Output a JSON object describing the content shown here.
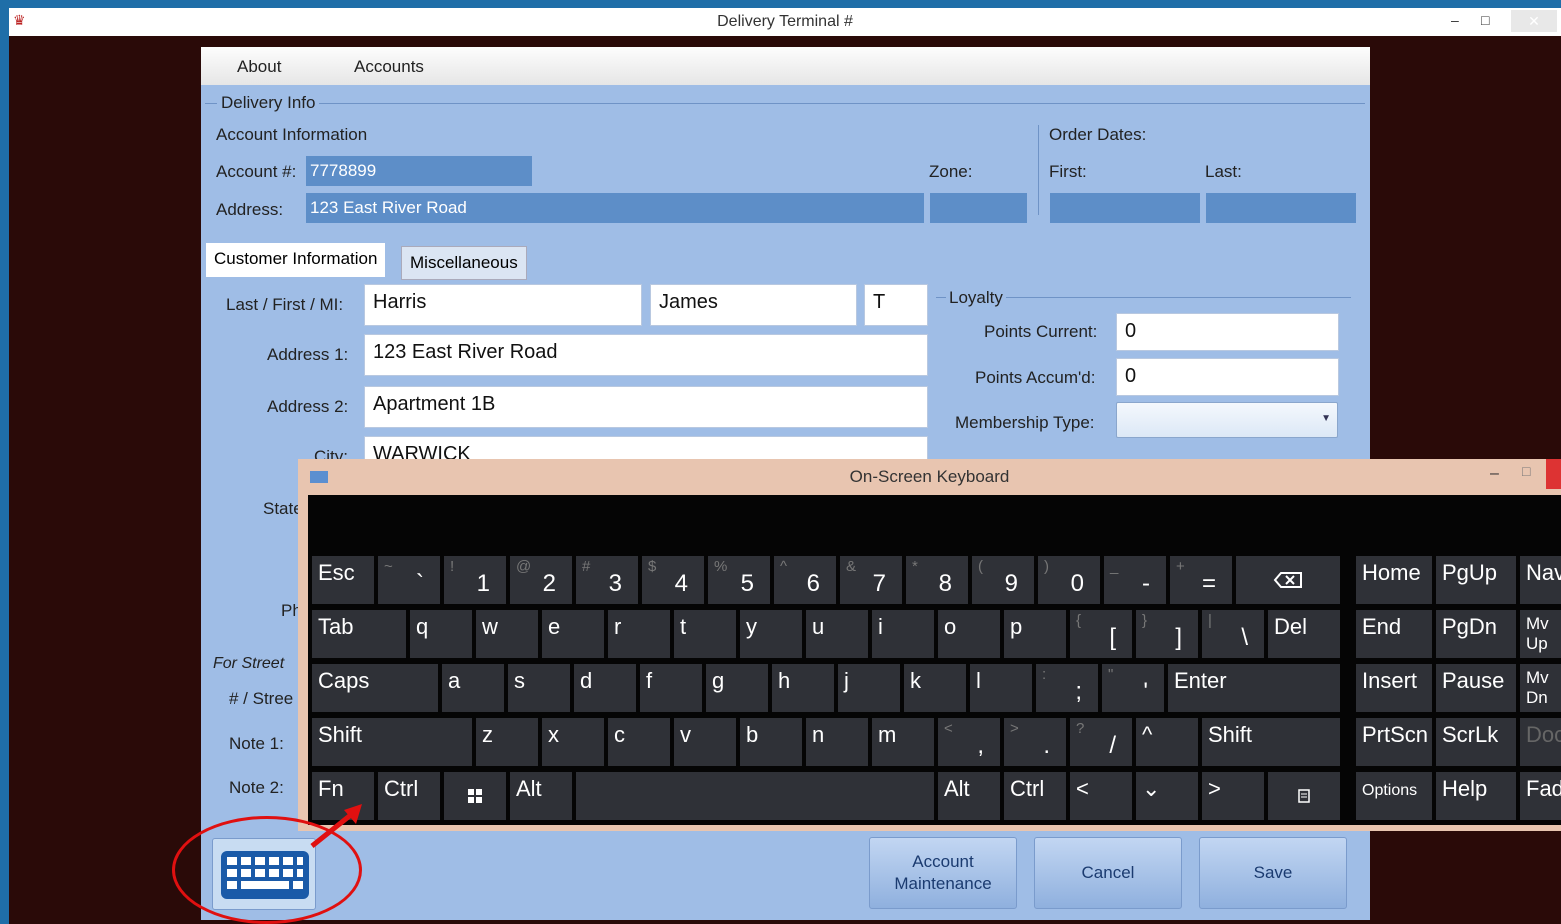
{
  "window": {
    "title": "Delivery Terminal #",
    "minimize": "–",
    "restore": "□",
    "close": "✕"
  },
  "menu": {
    "items": [
      "About",
      "Accounts"
    ]
  },
  "delivery": {
    "legend": "Delivery Info",
    "account_info": "Account Information",
    "account_label": "Account #:",
    "account_value": "7778899",
    "address_label": "Address:",
    "address_value": "123 East River Road",
    "zone_label": "Zone:",
    "order_dates": "Order Dates:",
    "first": "First:",
    "last": "Last:"
  },
  "tabs": [
    "Customer Information",
    "Miscellaneous"
  ],
  "customer": {
    "name_label": "Last / First / MI:",
    "last": "Harris",
    "first": "James",
    "mi": "T",
    "addr1_label": "Address 1:",
    "addr1": "123 East River Road",
    "addr2_label": "Address 2:",
    "addr2": "Apartment 1B",
    "city_label": "City:",
    "city": "WARWICK",
    "state_label": "State",
    "ph_label": "Ph",
    "street_legend": "For Street",
    "street_label": "# / Stree",
    "note1": "Note 1:",
    "note2": "Note 2:"
  },
  "loyalty": {
    "legend": "Loyalty",
    "points_current_label": "Points Current:",
    "points_current": "0",
    "points_accum_label": "Points Accum'd:",
    "points_accum": "0",
    "membership_label": "Membership Type:"
  },
  "buttons": {
    "account_maintenance": "Account Maintenance",
    "cancel": "Cancel",
    "save": "Save"
  },
  "osk": {
    "title": "On-Screen Keyboard",
    "row1": [
      [
        "Esc",
        ""
      ],
      [
        "~",
        "`"
      ],
      [
        "!",
        "1"
      ],
      [
        "@",
        "2"
      ],
      [
        "#",
        "3"
      ],
      [
        "$",
        "4"
      ],
      [
        "%",
        "5"
      ],
      [
        "^",
        "6"
      ],
      [
        "&",
        "7"
      ],
      [
        "*",
        "8"
      ],
      [
        "(",
        "9"
      ],
      [
        ")",
        "0"
      ],
      [
        "_",
        "-"
      ],
      [
        "+",
        "="
      ]
    ],
    "row2": [
      "Tab",
      "q",
      "w",
      "e",
      "r",
      "t",
      "y",
      "u",
      "i",
      "o",
      "p"
    ],
    "row2b": [
      [
        "{",
        "["
      ],
      [
        "}",
        "]"
      ],
      [
        "|",
        "\\"
      ]
    ],
    "del": "Del",
    "row3": [
      "Caps",
      "a",
      "s",
      "d",
      "f",
      "g",
      "h",
      "j",
      "k",
      "l"
    ],
    "row3b": [
      [
        ":",
        ";"
      ],
      [
        "\"",
        "'"
      ]
    ],
    "enter": "Enter",
    "row4": [
      "Shift",
      "z",
      "x",
      "c",
      "v",
      "b",
      "n",
      "m"
    ],
    "row4b": [
      [
        "<",
        ","
      ],
      [
        ">",
        "."
      ],
      [
        "?",
        "/"
      ]
    ],
    "up": "^",
    "shift_r": "Shift",
    "row5": [
      "Fn",
      "Ctrl",
      "",
      "Alt",
      "",
      "Alt",
      "Ctrl",
      "<",
      "⌄",
      ">",
      ""
    ],
    "nav": [
      [
        "Home",
        "PgUp",
        "Nav"
      ],
      [
        "End",
        "PgDn",
        "Mv Up"
      ],
      [
        "Insert",
        "Pause",
        "Mv Dn"
      ],
      [
        "PrtScn",
        "ScrLk",
        "Dock"
      ],
      [
        "Options",
        "Help",
        "Fade"
      ]
    ]
  }
}
